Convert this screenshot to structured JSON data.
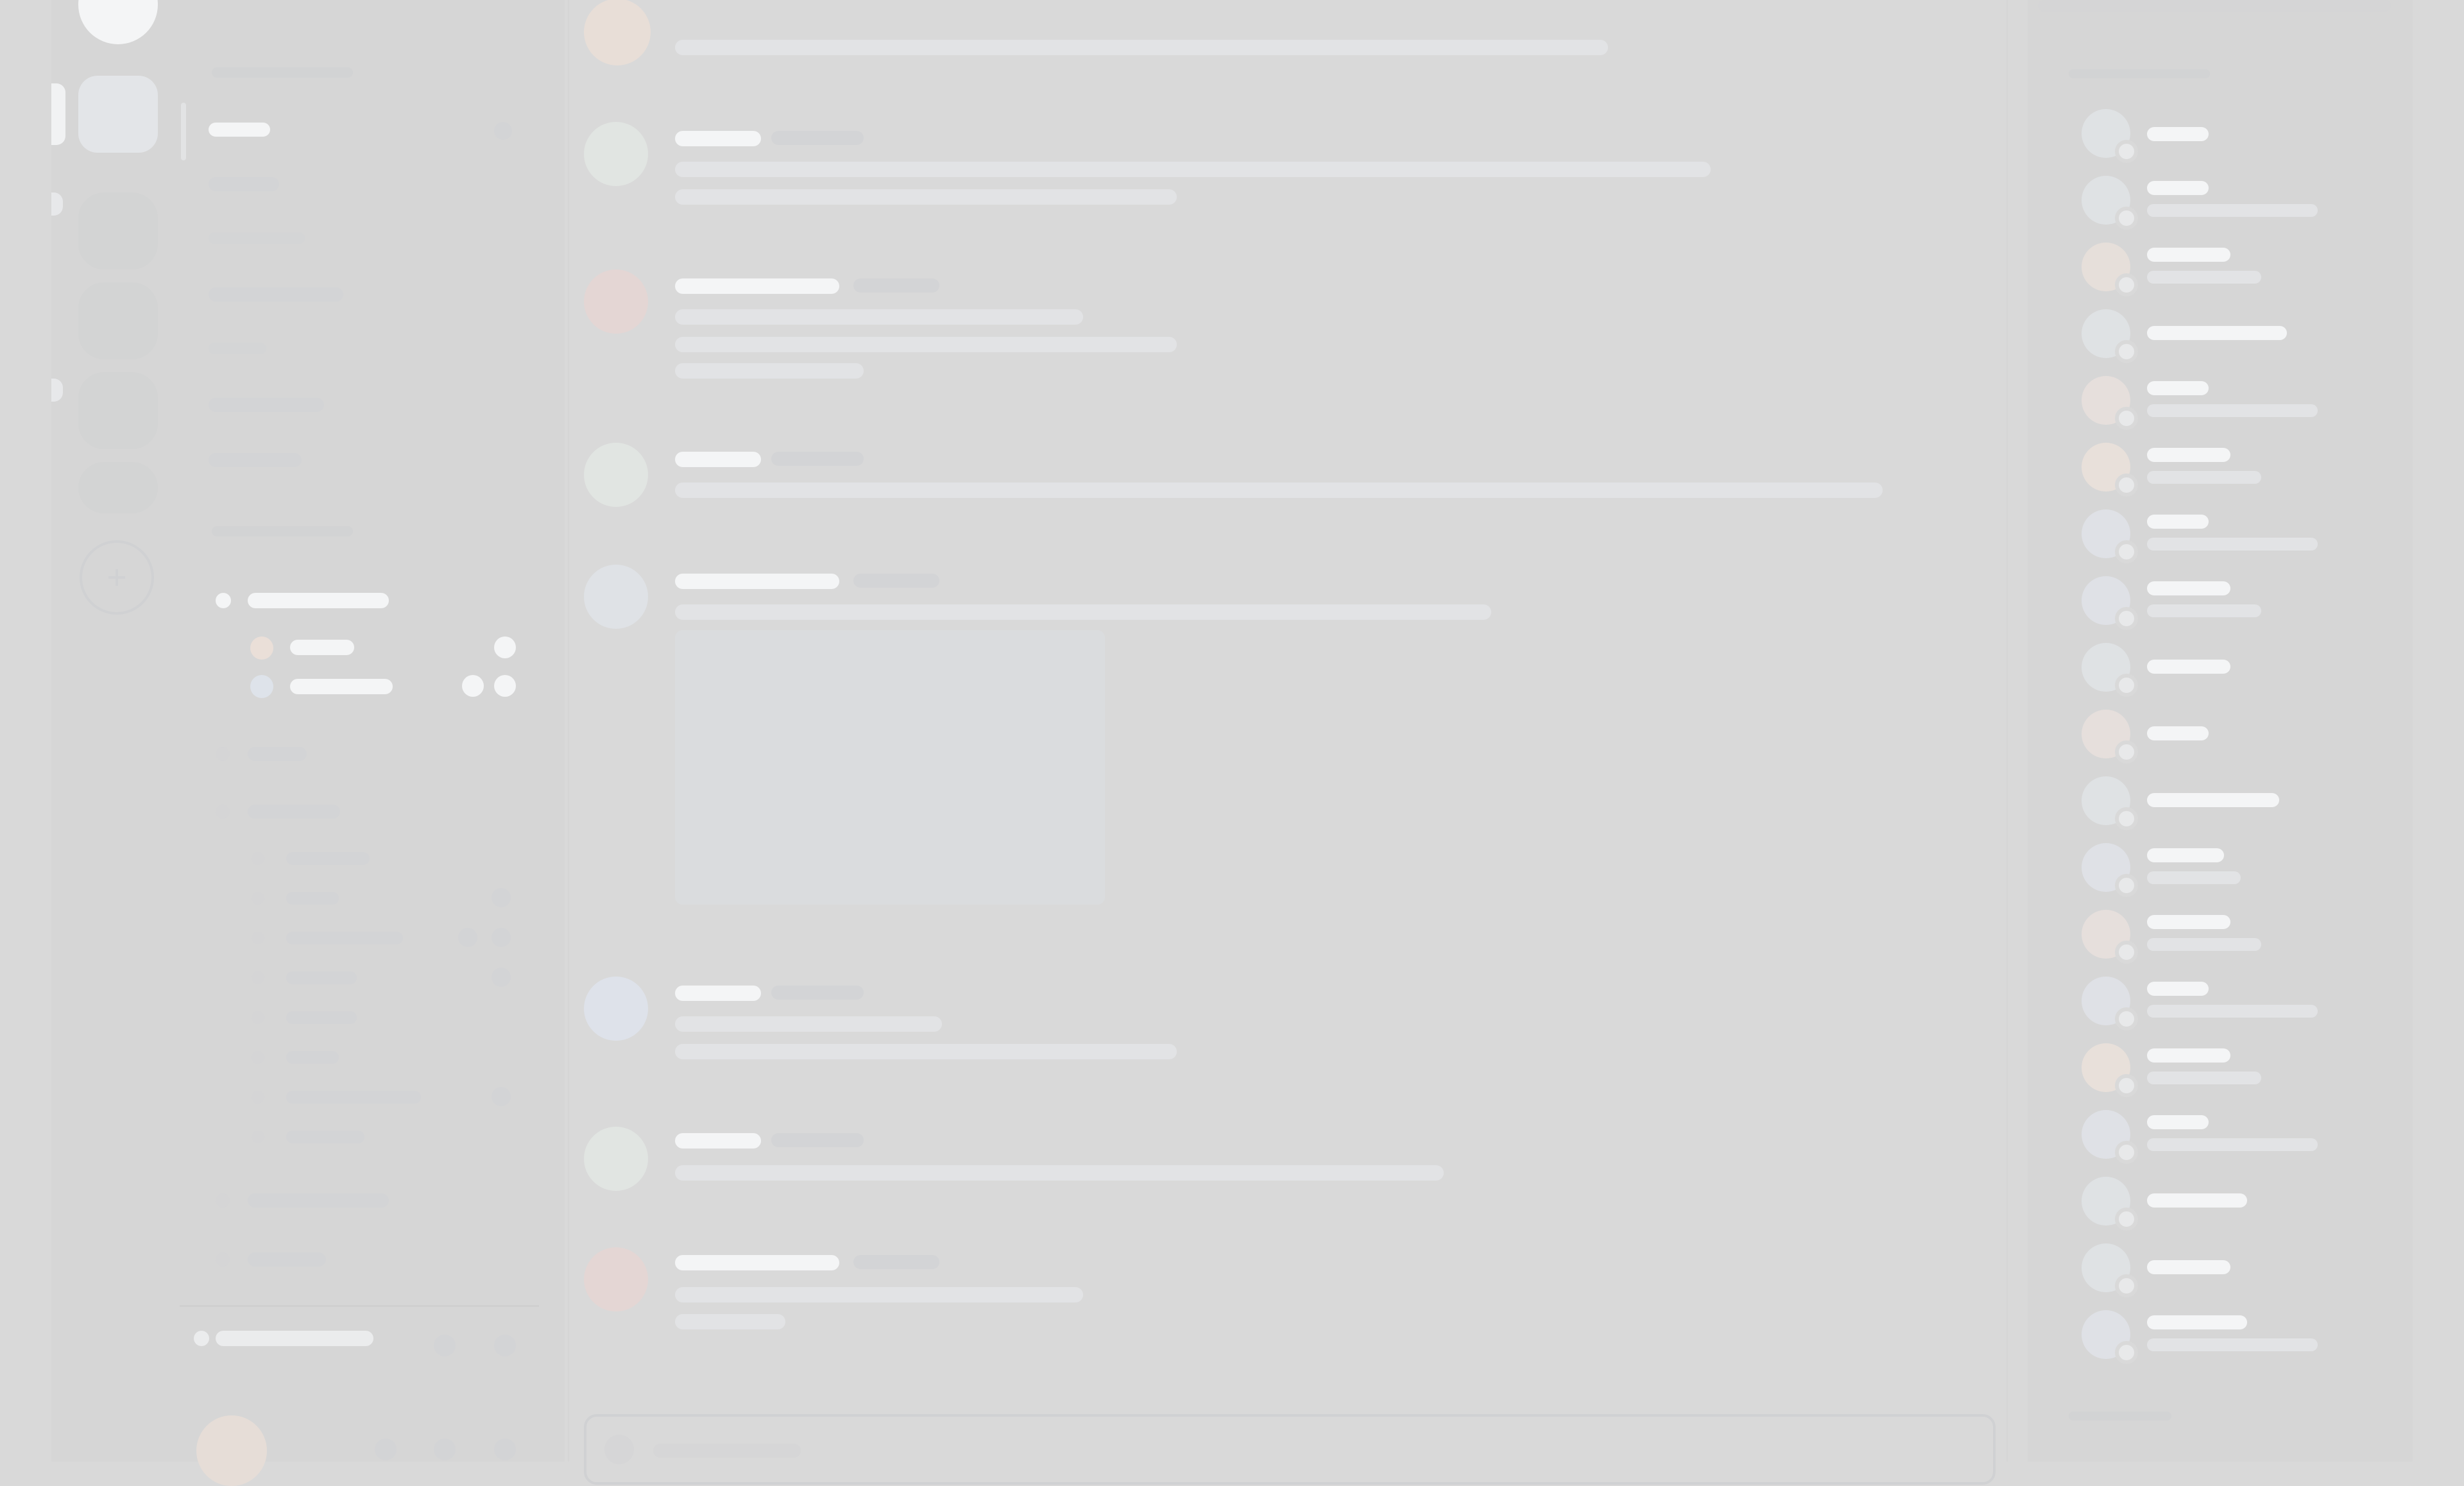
{
  "app": {
    "state": "loading-skeleton"
  },
  "palette": {
    "background": "#d9d9d9",
    "panel": "#d4d4d4",
    "skeleton_light": "#f4f5f6",
    "skeleton_mid": "#e2e3e5",
    "skeleton_dim": "#d3d4d6",
    "accent_warm": "#eadfd8",
    "accent_cool": "#dee3ea"
  },
  "icons": {
    "add_server": "plus-icon",
    "server_home": "app-logo-icon"
  }
}
